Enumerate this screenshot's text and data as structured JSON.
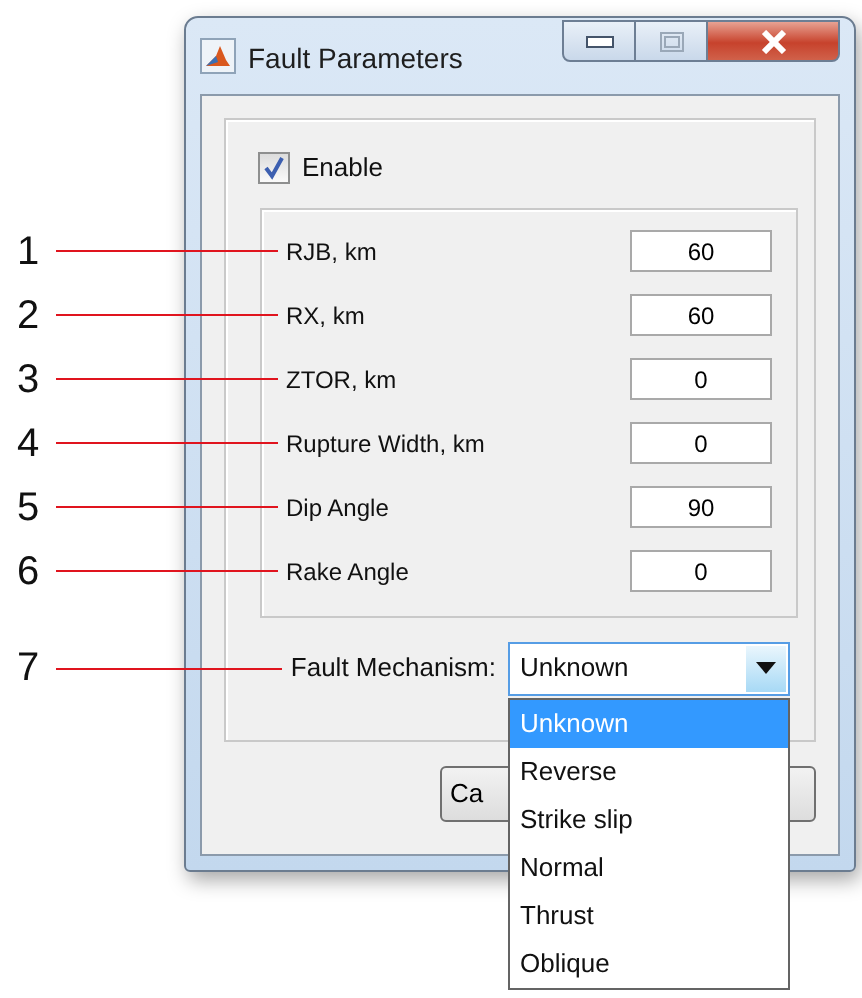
{
  "window": {
    "title": "Fault Parameters"
  },
  "enable": {
    "label": "Enable",
    "checked": true
  },
  "parameters": [
    {
      "number": "1",
      "label": "RJB, km",
      "value": "60"
    },
    {
      "number": "2",
      "label": "RX, km",
      "value": "60"
    },
    {
      "number": "3",
      "label": "ZTOR, km",
      "value": "0"
    },
    {
      "number": "4",
      "label": "Rupture Width, km",
      "value": "0"
    },
    {
      "number": "5",
      "label": "Dip Angle",
      "value": "90"
    },
    {
      "number": "6",
      "label": "Rake Angle",
      "value": "0"
    }
  ],
  "mechanism": {
    "number": "7",
    "label": "Fault Mechanism:",
    "value": "Unknown",
    "expanded": true,
    "options": [
      {
        "label": "Unknown",
        "selected": true
      },
      {
        "label": "Reverse",
        "selected": false
      },
      {
        "label": "Strike slip",
        "selected": false
      },
      {
        "label": "Normal",
        "selected": false
      },
      {
        "label": "Thrust",
        "selected": false
      },
      {
        "label": "Oblique",
        "selected": false
      }
    ]
  },
  "buttons": [
    {
      "label": "Ca"
    }
  ]
}
